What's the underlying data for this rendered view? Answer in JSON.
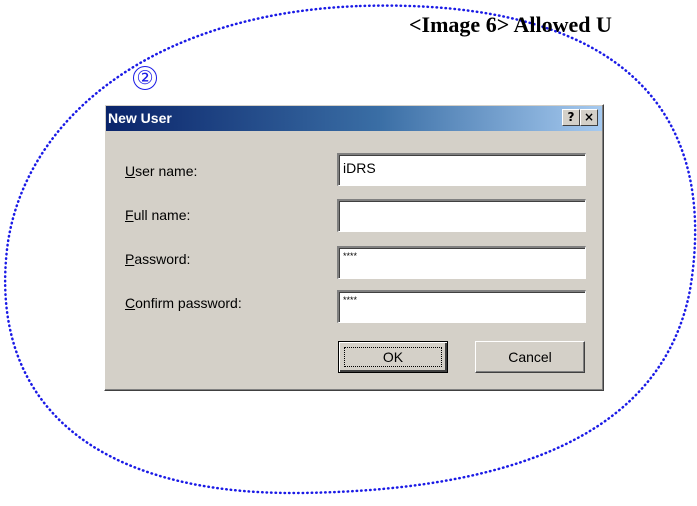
{
  "caption": "<Image 6> Allowed U",
  "marker": "②",
  "dialog": {
    "title": "New User",
    "help_glyph": "?",
    "close_glyph": "×",
    "fields": [
      {
        "label_key": "U",
        "label_rest": "ser name:",
        "value": "iDRS"
      },
      {
        "label_key": "F",
        "label_rest": "ull name:",
        "value": ""
      },
      {
        "label_key": "P",
        "label_rest": "assword:",
        "value": "****"
      },
      {
        "label_key": "C",
        "label_rest": "onfirm password:",
        "value": "****"
      }
    ],
    "ok_label": "OK",
    "cancel_label": "Cancel"
  }
}
